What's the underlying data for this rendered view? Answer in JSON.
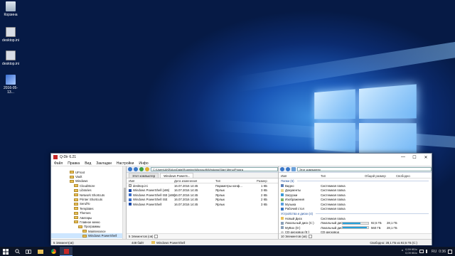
{
  "desktop": {
    "icons": [
      {
        "label": "Корзина"
      },
      {
        "label": "desktop.ini"
      },
      {
        "label": "desktop.ini"
      },
      {
        "label": "2016-05-13..."
      }
    ]
  },
  "taskbar": {
    "tray_lines": [
      "0,59 КБ/с",
      "0,09 КБ/с"
    ],
    "lang": "RU",
    "clock": "0:36"
  },
  "window": {
    "title": "Q-Dir 6.21",
    "controls": [
      "—",
      "☐",
      "✕"
    ],
    "menu": [
      "Файл",
      "Правка",
      "Вид",
      "Закладки",
      "Настройки",
      "Инфо"
    ]
  },
  "tree": {
    "items": [
      {
        "label": "UFroot",
        "indent": 0
      },
      {
        "label": "Vault",
        "indent": 0
      },
      {
        "label": "Windows",
        "indent": 0
      },
      {
        "label": "CloudStore",
        "indent": 1
      },
      {
        "label": "Libraries",
        "indent": 1
      },
      {
        "label": "Network Shortcuts",
        "indent": 1
      },
      {
        "label": "Printer Shortcuts",
        "indent": 1
      },
      {
        "label": "SendTo",
        "indent": 1
      },
      {
        "label": "Templates",
        "indent": 1
      },
      {
        "label": "Themes",
        "indent": 1
      },
      {
        "label": "Аватары",
        "indent": 1
      },
      {
        "label": "Главное меню",
        "indent": 1
      },
      {
        "label": "Программы",
        "indent": 2
      },
      {
        "label": "Maintenance",
        "indent": 3
      },
      {
        "label": "Windows PowerShell",
        "indent": 3,
        "selected": true
      }
    ]
  },
  "center": {
    "tabs": [
      "Этот компьютер",
      "Windows PowerS..."
    ],
    "address": "C:\\Users\\AKB\\AppData\\Roaming\\Microsoft\\Windows\\Start Menu\\Progra",
    "columns": [
      "Имя",
      "Дата изменения",
      "Тип",
      "Размер"
    ],
    "files": [
      {
        "name": "desktop.ini",
        "date": "16.07.2016 14:45",
        "type": "Параметры конф...",
        "size": "1 КБ"
      },
      {
        "name": "Windows PowerShell (x86)",
        "date": "16.07.2016 14:45",
        "type": "Ярлык",
        "size": "3 КБ"
      },
      {
        "name": "Windows PowerShell ISE (x86)",
        "date": "16.07.2016 14:45",
        "type": "Ярлык",
        "size": "2 КБ"
      },
      {
        "name": "Windows PowerShell ISE",
        "date": "16.07.2016 14:45",
        "type": "Ярлык",
        "size": "2 КБ"
      },
      {
        "name": "Windows PowerShell",
        "date": "16.07.2016 14:45",
        "type": "Ярлык",
        "size": "3 КБ"
      }
    ],
    "status": "5 Элементов (ов)"
  },
  "right": {
    "tab": "Этот компьютер",
    "columns": [
      "Имя",
      "Тип",
      "Общий размер",
      "Свободно"
    ],
    "group_folders": "Папки (6)",
    "folders": [
      {
        "name": "Видео",
        "type": "Системная папка"
      },
      {
        "name": "Документы",
        "type": "Системная папка"
      },
      {
        "name": "Загрузки",
        "type": "Системная папка"
      },
      {
        "name": "Изображения",
        "type": "Системная папка"
      },
      {
        "name": "Музыка",
        "type": "Системная папка"
      },
      {
        "name": "Рабочий стол",
        "type": "Системная папка"
      }
    ],
    "group_drives": "Устройства и диски (4)",
    "drives": [
      {
        "name": "Новый Диск",
        "type": "Системная папка",
        "total": "",
        "free": ""
      },
      {
        "name": "Локальный диск (C:)",
        "type": "Локальный диск",
        "total": "92,5 ГБ",
        "free": "28,1 ГБ",
        "used_fraction": 0.7
      },
      {
        "name": "MyBox (D:)",
        "type": "Локальный диск",
        "total": "560 ГБ",
        "free": "28,1 ГБ",
        "used_fraction": 0.95
      },
      {
        "name": "CD-дисковод (E:)",
        "type": "CD-дисковод",
        "total": "",
        "free": ""
      }
    ],
    "status": "10 Элементов (ов)"
  },
  "statusbar": {
    "left": "5 Элемент(ов)",
    "middle": "448 байт",
    "folder": "Windows PowerShell",
    "right": "Свободно: 28,1 ГБ из 92,5 ГБ (C:)"
  }
}
